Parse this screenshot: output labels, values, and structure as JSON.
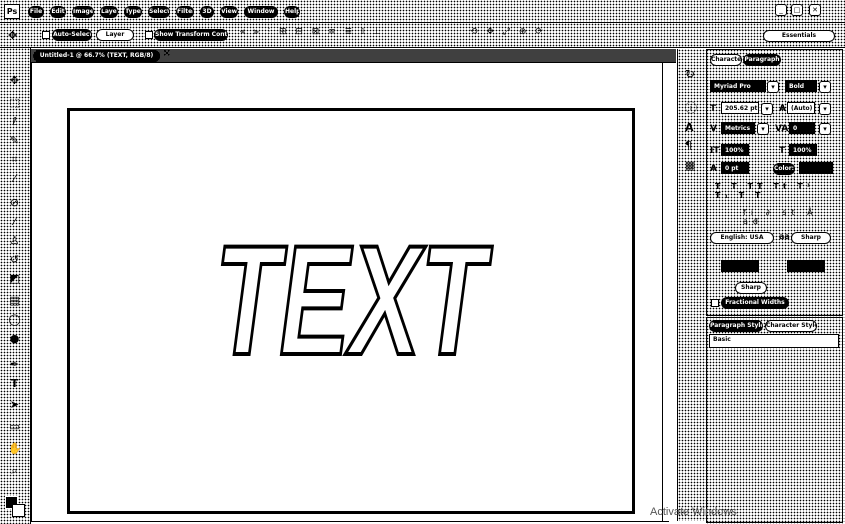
{
  "menu": [
    "File",
    "Edit",
    "Image",
    "Layer",
    "Type",
    "Select",
    "Filter",
    "3D",
    "View",
    "Window",
    "Help"
  ],
  "options_bar": {
    "auto_select_label": "Auto-Select",
    "auto_select_dropdown": "Layer",
    "transform_controls_label": "Show Transform Controls",
    "workspace_label": "Essentials"
  },
  "document_tab": {
    "title": "Untitled-1 @ 66.7% (TEXT, RGB/8)"
  },
  "canvas": {
    "text": "TEXT"
  },
  "panels": {
    "character_tab": "Character",
    "paragraph_tab": "Paragraph",
    "font_family": "Myriad Pro",
    "font_style": "Bold",
    "font_size": "205.62 pt",
    "leading": "(Auto)",
    "kerning": "Metrics",
    "tracking": "0",
    "vertical_scale": "100%",
    "horizontal_scale": "100%",
    "baseline_shift": "0 pt",
    "color_label": "Color:",
    "language": "English: USA",
    "antialias_label": "aa",
    "antialias_value": "Sharp",
    "faux_label": "Fractional Widths",
    "bottom_tab_1": "Paragraph Styles",
    "bottom_tab_2": "Character Styles",
    "bottom_item": "Basic"
  },
  "watermark": "Activate Windows"
}
